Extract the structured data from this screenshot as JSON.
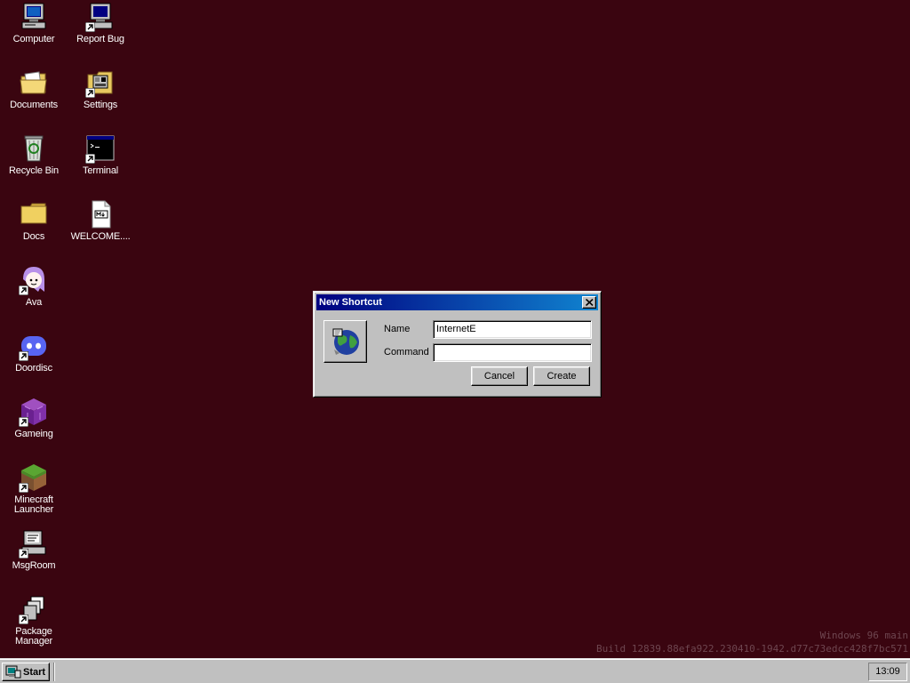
{
  "desktop": {
    "background_color": "#3a0510",
    "icons": [
      {
        "label": "Computer",
        "icon": "computer-icon"
      },
      {
        "label": "Report Bug",
        "icon": "report-bug-icon"
      },
      {
        "label": "Documents",
        "icon": "documents-folder-icon"
      },
      {
        "label": "Settings",
        "icon": "settings-icon"
      },
      {
        "label": "Recycle Bin",
        "icon": "recycle-bin-icon"
      },
      {
        "label": "Terminal",
        "icon": "terminal-icon"
      },
      {
        "label": "Docs",
        "icon": "folder-icon"
      },
      {
        "label": "WELCOME....",
        "icon": "markdown-file-icon"
      },
      {
        "label": "Ava",
        "icon": "ava-icon"
      },
      {
        "label": "Doordisc",
        "icon": "doordisc-icon"
      },
      {
        "label": "Gameing",
        "icon": "gameing-icon"
      },
      {
        "label": "Minecraft Launcher",
        "icon": "minecraft-icon"
      },
      {
        "label": "MsgRoom",
        "icon": "msgroom-icon"
      },
      {
        "label": "Package Manager",
        "icon": "package-manager-icon"
      }
    ]
  },
  "dialog": {
    "title": "New Shortcut",
    "icon": "globe-icon",
    "name_label": "Name",
    "name_value": "InternetE",
    "command_label": "Command",
    "command_value": "",
    "cancel_label": "Cancel",
    "create_label": "Create"
  },
  "watermark": {
    "line1": "Windows 96 main",
    "line2": "Build 12839.88efa922.230410-1942.d77c73edcc428f7bc571"
  },
  "taskbar": {
    "start_label": "Start",
    "clock": "13:09"
  }
}
